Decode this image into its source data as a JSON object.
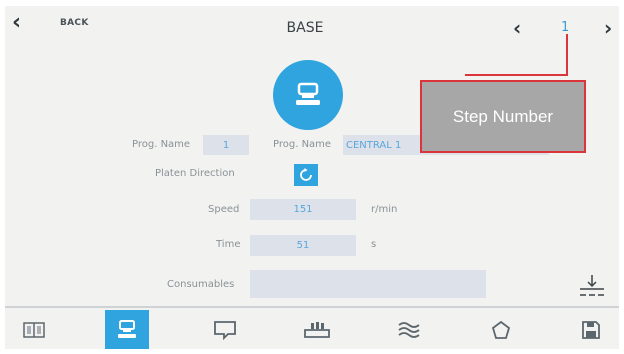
{
  "header": {
    "back_label": "BACK",
    "title": "BASE",
    "step_number": "1"
  },
  "form": {
    "prog_name_label": "Prog. Name",
    "prog_number": "1",
    "prog_name_label_2": "Prog. Name",
    "prog_name_value": "CENTRAL 1",
    "platen_direction_label": "Platen Direction",
    "speed_label": "Speed",
    "speed_value": "151",
    "speed_unit": "r/min",
    "time_label": "Time",
    "time_value": "51",
    "time_unit": "s",
    "consumables_label": "Consumables",
    "consumables_value": ""
  },
  "callout": {
    "text": "Step Number"
  },
  "tabs": [
    {
      "icon": "book-icon",
      "active": false
    },
    {
      "icon": "base-machine-icon",
      "active": true
    },
    {
      "icon": "speech-bubble-icon",
      "active": false
    },
    {
      "icon": "platen-icon",
      "active": false
    },
    {
      "icon": "waves-icon",
      "active": false
    },
    {
      "icon": "pentagon-icon",
      "active": false
    },
    {
      "icon": "save-icon",
      "active": false
    }
  ],
  "colors": {
    "accent": "#2fa4de",
    "callout_border": "#d9353b",
    "callout_bg": "#a7a7a7"
  }
}
